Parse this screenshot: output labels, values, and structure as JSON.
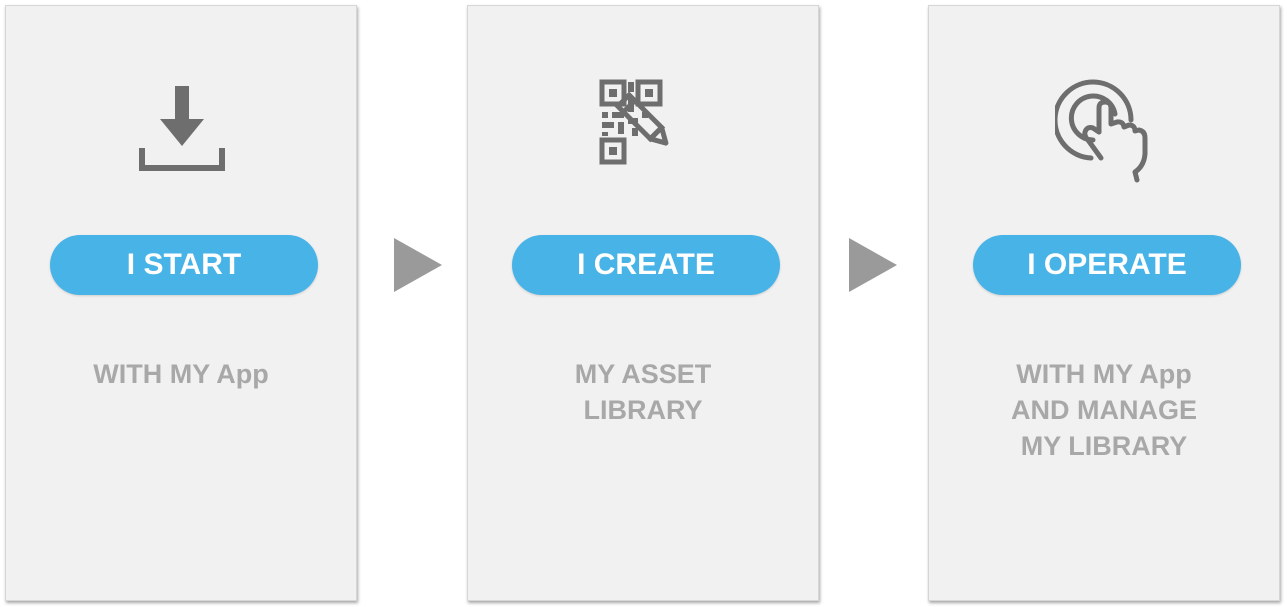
{
  "steps": [
    {
      "icon": "download-icon",
      "button_label": "I START",
      "description_lines": [
        "WITH MY App"
      ]
    },
    {
      "icon": "qr-code-edit-icon",
      "button_label": "I CREATE",
      "description_lines": [
        "MY ASSET",
        "LIBRARY"
      ]
    },
    {
      "icon": "touch-tap-icon",
      "button_label": "I OPERATE",
      "description_lines": [
        "WITH MY App",
        "AND MANAGE",
        "MY LIBRARY"
      ]
    }
  ],
  "arrows": [
    "right-arrow-icon",
    "right-arrow-icon"
  ],
  "colors": {
    "card_background": "#f1f1f1",
    "button_background": "#47b3e6",
    "button_text": "#ffffff",
    "description_text": "#a8a8a8",
    "icon_color": "#6e6e6e",
    "arrow_color": "#9a9a9a"
  }
}
